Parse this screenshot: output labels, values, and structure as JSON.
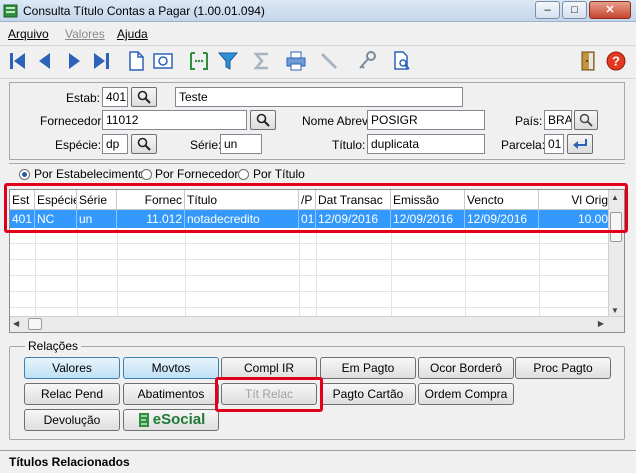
{
  "window": {
    "title": "Consulta Título Contas a Pagar (1.00.01.094)",
    "controls": [
      "minimize-icon",
      "maximize-icon",
      "close-icon"
    ]
  },
  "menu": {
    "items": [
      {
        "label": "Arquivo",
        "enabled": true
      },
      {
        "label": "Valores",
        "enabled": false
      },
      {
        "label": "Ajuda",
        "enabled": true
      }
    ]
  },
  "toolbar": {
    "icons": [
      "first-record-icon",
      "previous-record-icon",
      "next-record-icon",
      "last-record-icon",
      "document-icon",
      "preview-icon",
      "goto-icon",
      "filter-icon",
      "sum-icon",
      "print-icon",
      "pencil-icon",
      "key-icon",
      "document-search-icon",
      "exit-icon",
      "help-icon"
    ]
  },
  "form": {
    "estab_label": "Estab:",
    "estab_value": "401",
    "estab_name": "Teste",
    "fornecedor_label": "Fornecedor:",
    "fornecedor_value": "11012",
    "nome_abrev_label": "Nome Abrev:",
    "nome_abrev_value": "POSIGR",
    "pais_label": "País:",
    "pais_value": "BRA",
    "especie_label": "Espécie:",
    "especie_value": "dp",
    "serie_label": "Série:",
    "serie_value": "un",
    "titulo_label": "Título:",
    "titulo_value": "duplicata",
    "parcela_label": "Parcela:",
    "parcela_value": "01"
  },
  "order": {
    "options": [
      {
        "label": "Por Estabelecimento",
        "selected": true
      },
      {
        "label": "Por Fornecedor",
        "selected": false
      },
      {
        "label": "Por Título",
        "selected": false
      }
    ]
  },
  "grid": {
    "columns": [
      "Est",
      "Espécie",
      "Série",
      "Fornec",
      "Título",
      "/P",
      "Dat Transac",
      "Emissão",
      "Vencto",
      "Vl Orig"
    ],
    "rows": [
      [
        "401",
        "NC",
        "un",
        "11.012",
        "notadecredito",
        "01",
        "12/09/2016",
        "12/09/2016",
        "12/09/2016",
        "10.00"
      ]
    ]
  },
  "relacoes": {
    "label": "Relações",
    "buttons": [
      {
        "label": "Valores",
        "style": "blue"
      },
      {
        "label": "Movtos",
        "style": "blue"
      },
      {
        "label": "Compl IR",
        "style": "normal"
      },
      {
        "label": "Em Pagto",
        "style": "normal"
      },
      {
        "label": "Ocor Borderô",
        "style": "normal"
      },
      {
        "label": "Proc Pagto",
        "style": "normal"
      },
      {
        "label": "Relac Pend",
        "style": "normal"
      },
      {
        "label": "Abatimentos",
        "style": "normal"
      },
      {
        "label": "Tít Relac",
        "style": "disabled"
      },
      {
        "label": "Pagto Cartão",
        "style": "normal"
      },
      {
        "label": "Ordem Compra",
        "style": "normal"
      },
      {
        "label": "Devolução",
        "style": "normal"
      }
    ],
    "esocial": "eSocial"
  },
  "status": {
    "text": "Títulos Relacionados"
  },
  "colors": {
    "selection": "#3399ff",
    "highlight": "#e0001a",
    "blue_button": "#bfe0f6"
  }
}
